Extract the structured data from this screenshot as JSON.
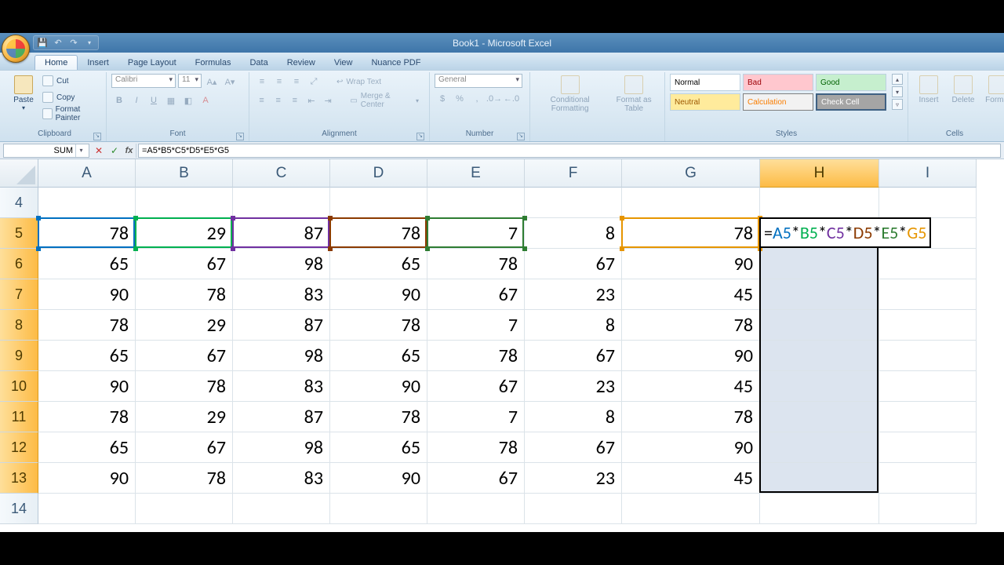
{
  "title": "Book1 - Microsoft Excel",
  "qat": {
    "save": "save-icon",
    "undo": "undo-icon",
    "redo": "redo-icon"
  },
  "tabs": [
    "Home",
    "Insert",
    "Page Layout",
    "Formulas",
    "Data",
    "Review",
    "View",
    "Nuance PDF"
  ],
  "activeTab": "Home",
  "ribbon": {
    "clipboard": {
      "label": "Clipboard",
      "paste": "Paste",
      "cut": "Cut",
      "copy": "Copy",
      "fmt": "Format Painter"
    },
    "font": {
      "label": "Font",
      "name": "Calibri",
      "size": "11"
    },
    "alignment": {
      "label": "Alignment",
      "wrap": "Wrap Text",
      "merge": "Merge & Center"
    },
    "number": {
      "label": "Number",
      "format": "General"
    },
    "styles": {
      "label": "Styles",
      "cond": "Conditional Formatting",
      "table": "Format as Table",
      "cells": [
        "Normal",
        "Bad",
        "Good",
        "Neutral",
        "Calculation",
        "Check Cell"
      ]
    },
    "cells": {
      "label": "Cells",
      "insert": "Insert",
      "delete": "Delete",
      "format": "Format"
    }
  },
  "nameBox": "SUM",
  "formula": "=A5*B5*C5*D5*E5*G5",
  "formulaTokens": [
    {
      "t": "=",
      "c": ""
    },
    {
      "t": "A5",
      "c": "cA"
    },
    {
      "t": "*",
      "c": ""
    },
    {
      "t": "B5",
      "c": "cB"
    },
    {
      "t": "*",
      "c": ""
    },
    {
      "t": "C5",
      "c": "cC"
    },
    {
      "t": "*",
      "c": ""
    },
    {
      "t": "D5",
      "c": "cD"
    },
    {
      "t": "*",
      "c": ""
    },
    {
      "t": "E5",
      "c": "cE"
    },
    {
      "t": "*",
      "c": ""
    },
    {
      "t": "G5",
      "c": "cG"
    }
  ],
  "cols": [
    "A",
    "B",
    "C",
    "D",
    "E",
    "F",
    "G",
    "H",
    "I"
  ],
  "selectedCol": "H",
  "rows": [
    4,
    5,
    6,
    7,
    8,
    9,
    10,
    11,
    12,
    13,
    14
  ],
  "selectedRowsHeader": [
    5,
    6,
    7,
    8,
    9,
    10,
    11,
    12,
    13
  ],
  "refBoxes": [
    {
      "col": "A",
      "color": "#0070c0"
    },
    {
      "col": "B",
      "color": "#00b050"
    },
    {
      "col": "C",
      "color": "#7030a0"
    },
    {
      "col": "D",
      "color": "#8b3a00"
    },
    {
      "col": "E",
      "color": "#2e7d32"
    },
    {
      "col": "G",
      "color": "#e69500"
    }
  ],
  "chart_data": {
    "type": "table",
    "columns": [
      "A",
      "B",
      "C",
      "D",
      "E",
      "F",
      "G"
    ],
    "rows": [
      5,
      6,
      7,
      8,
      9,
      10,
      11,
      12,
      13
    ],
    "data": [
      [
        78,
        29,
        87,
        78,
        7,
        8,
        78
      ],
      [
        65,
        67,
        98,
        65,
        78,
        67,
        90
      ],
      [
        90,
        78,
        83,
        90,
        67,
        23,
        45
      ],
      [
        78,
        29,
        87,
        78,
        7,
        8,
        78
      ],
      [
        65,
        67,
        98,
        65,
        78,
        67,
        90
      ],
      [
        90,
        78,
        83,
        90,
        67,
        23,
        45
      ],
      [
        78,
        29,
        87,
        78,
        7,
        8,
        78
      ],
      [
        65,
        67,
        98,
        65,
        78,
        67,
        90
      ],
      [
        90,
        78,
        83,
        90,
        67,
        23,
        45
      ]
    ]
  }
}
